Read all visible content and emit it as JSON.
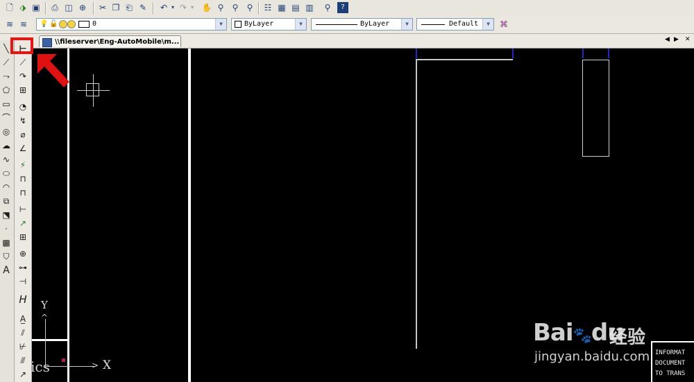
{
  "toolbar_top": {
    "icons": [
      "new-icon",
      "open-icon",
      "save-icon",
      "print-icon",
      "preview-icon",
      "publish-icon",
      "plot-icon",
      "cut-icon",
      "copy-icon",
      "paste-icon",
      "match-properties-icon",
      "undo-icon",
      "redo-icon",
      "pan-icon",
      "zoom-realtime-icon",
      "zoom-window-icon",
      "zoom-previous-icon",
      "properties-icon",
      "design-center-icon",
      "tool-palettes-icon",
      "sheet-set-icon",
      "markup-icon",
      "calculator-icon",
      "help-icon"
    ]
  },
  "layer_toolbar": {
    "layer_name": "0",
    "color_value": "ByLayer",
    "linetype_value": "ByLayer",
    "lineweight_value": "Default"
  },
  "document_tab": {
    "title": "\\\\fileserver\\Eng-AutoMobile\\m..."
  },
  "draw_toolbar_icons": [
    "line-icon",
    "construction-line-icon",
    "polyline-icon",
    "polygon-icon",
    "rectangle-icon",
    "arc-icon",
    "circle-icon",
    "revision-cloud-icon",
    "spline-icon",
    "ellipse-icon",
    "ellipse-arc-icon",
    "insert-block-icon",
    "make-block-icon",
    "point-icon",
    "hatch-icon",
    "region-icon",
    "multiline-text-icon"
  ],
  "dimension_toolbar_icons": [
    "linear-dimension-icon",
    "aligned-dimension-icon",
    "arc-length-icon",
    "ordinate-icon",
    "radius-icon",
    "jogged-icon",
    "diameter-icon",
    "angular-icon",
    "quick-dimension-icon",
    "baseline-icon",
    "continue-icon",
    "quick-leader-icon",
    "tolerance-icon",
    "center-mark-icon",
    "dimension-edit-icon",
    "dimension-text-edit-icon",
    "dimension-update-icon",
    "dimension-style-icon",
    "text-style-icon",
    "align-icon",
    "dimension-break-icon",
    "oblique-icon"
  ],
  "canvas": {
    "background": "#000000",
    "ucs_x_label": "X",
    "ucs_y_label": "Y",
    "text_fragment": "ics",
    "title_block_lines": [
      "INFORMAT",
      "DOCUMENT",
      "TO TRANS"
    ]
  },
  "watermark": {
    "logo": "Bai",
    "logo_suffix": "du",
    "chinese": "经验",
    "url": "jingyan.baidu.com"
  },
  "annotation": {
    "highlight_color": "#e11111",
    "arrow_color": "#e11111"
  }
}
